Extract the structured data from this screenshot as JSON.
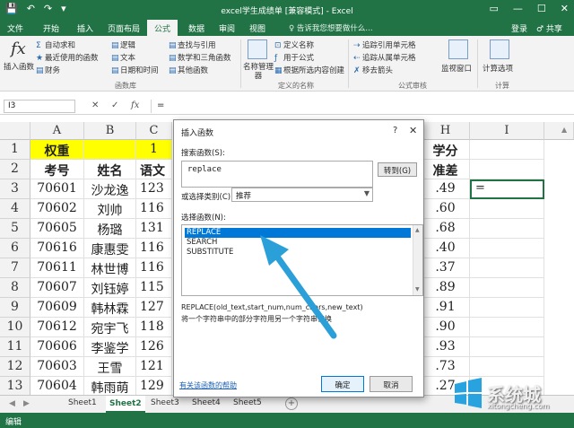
{
  "titlebar": {
    "title": "excel学生成绩单 [兼容模式] - Excel",
    "qat_save": "💾",
    "qat_undo": "↶",
    "qat_redo": "↷",
    "qat_more": "▾",
    "win_ribbon": "▭",
    "win_min": "—",
    "win_max": "☐",
    "win_close": "✕"
  },
  "tabs": {
    "items": [
      "文件",
      "开始",
      "插入",
      "页面布局",
      "公式",
      "数据",
      "审阅",
      "视图"
    ],
    "active": "公式",
    "search_placeholder": "♀ 告诉我您想要做什么...",
    "login": "登录",
    "share": "♂ 共享"
  },
  "ribbon": {
    "insert_fn": "插入函数",
    "autosum": "自动求和",
    "recent": "最近使用的函数",
    "financial": "财务",
    "logical": "逻辑",
    "text": "文本",
    "datetime": "日期和时间",
    "lookup": "查找与引用",
    "math": "数学和三角函数",
    "other": "其他函数",
    "group_library": "函数库",
    "name_mgr": "名称管理器",
    "define_name": "定义名称",
    "use_in_formula": "用于公式",
    "create_from_sel": "根据所选内容创建",
    "group_names": "定义的名称",
    "trace_prec": "追踪引用单元格",
    "trace_dep": "追踪从属单元格",
    "remove_arrows": "移去箭头",
    "group_audit": "公式审核",
    "watch": "监视窗口",
    "calc_opts": "计算选项",
    "group_calc": "计算"
  },
  "formula_bar": {
    "namebox": "I3",
    "cancel": "✕",
    "enter": "✓",
    "fx": "fx",
    "content": "="
  },
  "grid": {
    "columns": [
      "A",
      "B",
      "C",
      "H",
      "I"
    ],
    "rows": [
      "1",
      "2",
      "3",
      "4",
      "5",
      "6",
      "7",
      "8",
      "9",
      "10",
      "11",
      "12",
      "13"
    ],
    "r1": {
      "a": "权重",
      "c": "1",
      "h": "学分"
    },
    "r2": {
      "a": "考号",
      "b": "姓名",
      "c": "语文",
      "h": "准差"
    },
    "data": [
      [
        "70601",
        "沙龙逸",
        "123",
        ".49"
      ],
      [
        "70602",
        "刘帅",
        "116",
        ".60"
      ],
      [
        "70605",
        "杨璐",
        "131",
        ".68"
      ],
      [
        "70616",
        "康惠雯",
        "116",
        ".40"
      ],
      [
        "70611",
        "林世博",
        "116",
        ".37"
      ],
      [
        "70607",
        "刘钰婷",
        "115",
        ".89"
      ],
      [
        "70609",
        "韩林霖",
        "127",
        ".91"
      ],
      [
        "70612",
        "宛宇飞",
        "118",
        ".90"
      ],
      [
        "70606",
        "李鉴学",
        "126",
        ".93"
      ],
      [
        "70603",
        "王雪",
        "121",
        ".73"
      ],
      [
        "70604",
        "韩雨萌",
        "129",
        ".27"
      ]
    ],
    "active_value": "="
  },
  "sheets": {
    "items": [
      "Sheet1",
      "Sheet2",
      "Sheet3",
      "Sheet4",
      "Sheet5"
    ],
    "active": "Sheet2",
    "add": "+"
  },
  "status": {
    "mode": "编辑"
  },
  "dialog": {
    "title": "插入函数",
    "help": "?",
    "close": "✕",
    "search_label": "搜索函数(S):",
    "search_value": "replace",
    "goto": "转到(G)",
    "category_label": "或选择类别(C):",
    "category_value": "推荐",
    "list_label": "选择函数(N):",
    "functions": [
      "REPLACE",
      "SEARCH",
      "SUBSTITUTE"
    ],
    "syntax": "REPLACE(old_text,start_num,num_chars,new_text)",
    "description": "将一个字符串中的部分字符用另一个字符串替换",
    "help_link": "有关该函数的帮助",
    "ok": "确定",
    "cancel": "取消"
  },
  "watermark": {
    "text": "系统城",
    "url": "xitongcheng.com"
  },
  "colors": {
    "excel_green": "#217346",
    "highlight_yellow": "#ffff00",
    "selection_blue": "#0078d7",
    "arrow_blue": "#2b9fd8"
  }
}
